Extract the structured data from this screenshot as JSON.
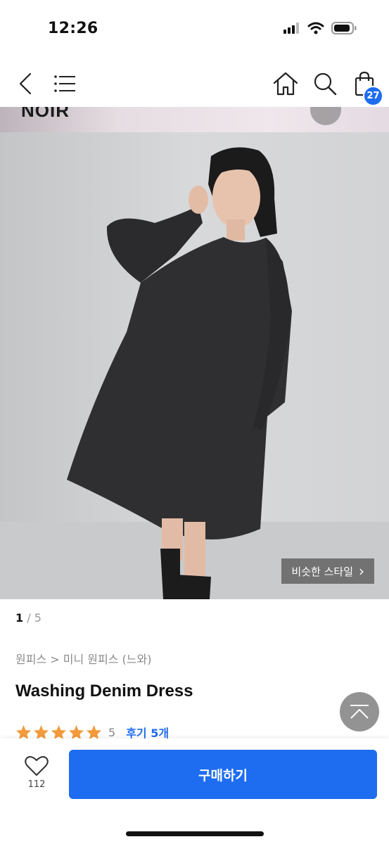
{
  "status_bar": {
    "time": "12:26",
    "icons": [
      "signal-icon",
      "wifi-icon",
      "battery-icon"
    ]
  },
  "nav": {
    "icons": [
      "back-icon",
      "menu-icon",
      "home-icon",
      "search-icon",
      "shopping-bag-icon"
    ],
    "cart_count": "27"
  },
  "product_image": {
    "brand_logo": "NOIR",
    "similar_style_label": "비슷한 스타일",
    "similar_style_chevron": "›"
  },
  "pager": {
    "current": "1",
    "separator": " / ",
    "total": "5"
  },
  "breadcrumb": "원피스 > 미니 원피스 (느와)",
  "product": {
    "title": "Washing Denim Dress",
    "rating_value": 5,
    "rating_label": "5",
    "review_label": "후기 5개"
  },
  "bottom_bar": {
    "like_count": "112",
    "buy_label": "구매하기"
  },
  "colors": {
    "accent": "#1e6cf0",
    "star": "#f39a3a",
    "text_muted": "#8a8a8a"
  }
}
